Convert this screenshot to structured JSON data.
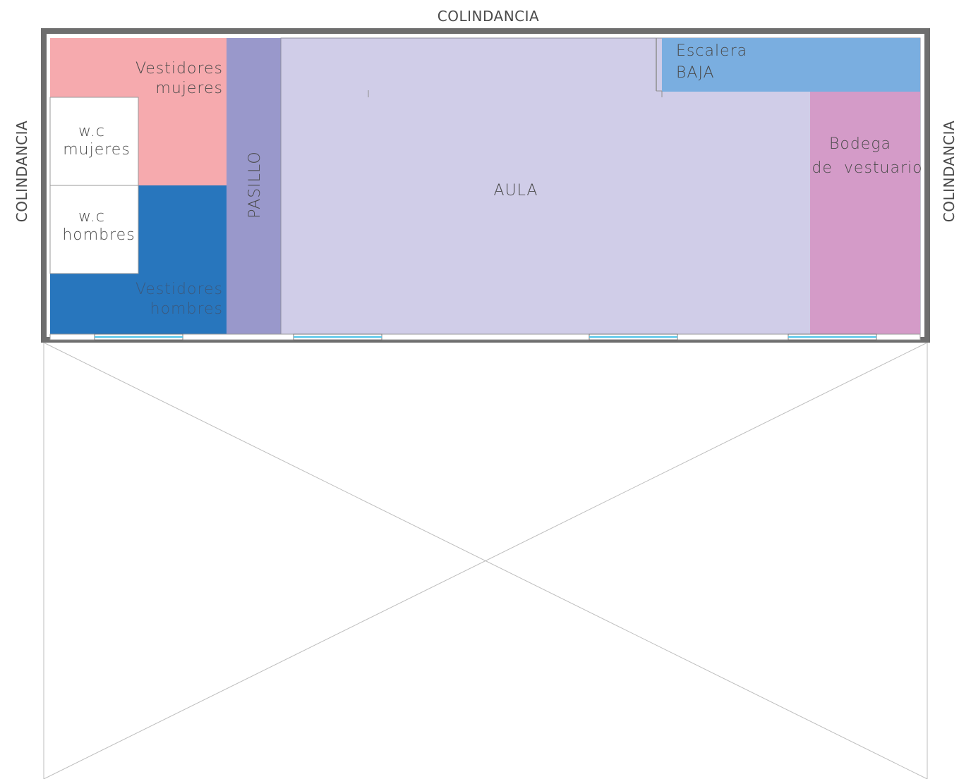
{
  "boundaries": {
    "top": "COLINDANCIA",
    "left": "COLINDANCIA",
    "right": "COLINDANCIA"
  },
  "rooms": {
    "vestidores_mujeres": {
      "line1": "Vestidores",
      "line2": "mujeres",
      "color": "#f6aaae"
    },
    "wc_mujeres": {
      "line1": "w.c",
      "line2": "mujeres",
      "color": "#ffffff"
    },
    "wc_hombres": {
      "line1": "w.c",
      "line2": "hombres",
      "color": "#ffffff"
    },
    "vestidores_hombres": {
      "line1": "Vestidores",
      "line2": "hombres",
      "color": "#2876bd"
    },
    "pasillo": {
      "label": "PASILLO",
      "color": "#9998cb"
    },
    "aula": {
      "label": "AULA",
      "color": "#d0cde8"
    },
    "escalera": {
      "line1": "Escalera",
      "line2": "BAJA",
      "color": "#7aaee0"
    },
    "bodega": {
      "line1": "Bodega",
      "line2": "de  vestuario",
      "color": "#d49bc8"
    }
  },
  "colors": {
    "wall": "#6e6e6e",
    "window": "#4fc3e8",
    "outline": "#b8b8b8"
  }
}
